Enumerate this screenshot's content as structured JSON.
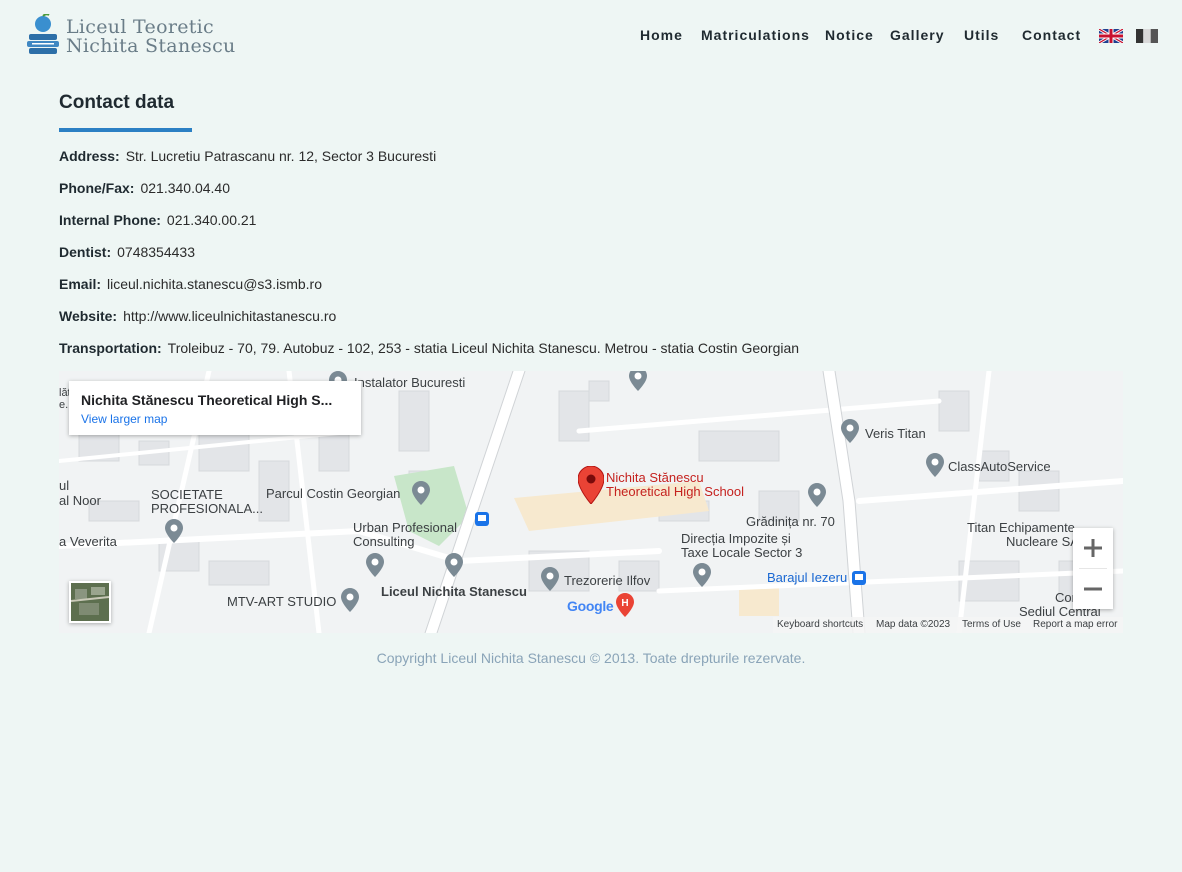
{
  "header": {
    "logo_line1": "Liceul Teoretic",
    "logo_line2": "Nichita Stanescu",
    "nav": [
      "Home",
      "Matriculations",
      "Notice",
      "Gallery",
      "Utils",
      "Contact"
    ],
    "languages": [
      "English",
      "Romanian"
    ]
  },
  "contact": {
    "title": "Contact data",
    "rows": [
      {
        "label": "Address:",
        "value": "Str. Lucretiu Patrascanu nr. 12, Sector 3 Bucuresti"
      },
      {
        "label": "Phone/Fax:",
        "value": "021.340.04.40"
      },
      {
        "label": "Internal Phone:",
        "value": "021.340.00.21"
      },
      {
        "label": "Dentist:",
        "value": "0748354433"
      },
      {
        "label": "Email:",
        "value": "liceul.nichita.stanescu@s3.ismb.ro"
      },
      {
        "label": "Website:",
        "value": "http://www.liceulnichitastanescu.ro"
      },
      {
        "label": "Transportation:",
        "value": "Troleibuz - 70, 79. Autobuz - 102, 253 - statia Liceul Nichita Stanescu. Metrou - statia Costin Georgian"
      }
    ]
  },
  "map": {
    "card_title": "Nichita Stănescu Theoretical High S...",
    "card_link": "View larger map",
    "labels": {
      "instalator": "Instalator Bucuresti",
      "veris": "Veris Titan",
      "classauto": "ClassAutoService",
      "school_1": "Nichita Stănescu",
      "school_2": "Theoretical High School",
      "societate_1": "SOCIETATE",
      "societate_2": "PROFESIONALA...",
      "parcul": "Parcul Costin Georgian",
      "noor": "al Noor",
      "urban_1": "Urban Profesional",
      "urban_2": "Consulting",
      "veverita": "a Veverita",
      "gradinita": "Grădinița nr. 70",
      "directia_1": "Direcția Impozite și",
      "directia_2": "Taxe Locale Sector 3",
      "titan_1": "Titan Echipamente",
      "titan_2": "Nucleare SA",
      "liceul": "Liceul Nichita Stanescu",
      "trezorerie": "Trezorerie Ilfov",
      "barajul": "Barajul Iezeru",
      "mtv": "MTV-ART STUDIO",
      "consol_1": "Consol",
      "consol_2": "Sediul Central",
      "ul": "ul",
      "edge_1": "lăt",
      "edge_2": "e..."
    },
    "google": "Google",
    "footer": {
      "shortcuts": "Keyboard shortcuts",
      "mapdata": "Map data ©2023",
      "terms": "Terms of Use",
      "report": "Report a map error"
    },
    "zoom_in": "+",
    "zoom_out": "−"
  },
  "footer": {
    "copyright": "Copyright Liceul Nichita Stanescu © 2013. Toate drepturile rezervate."
  },
  "colors": {
    "accent": "#2b80c4",
    "background": "#eef6f4",
    "map_pin": "#ea4335"
  }
}
